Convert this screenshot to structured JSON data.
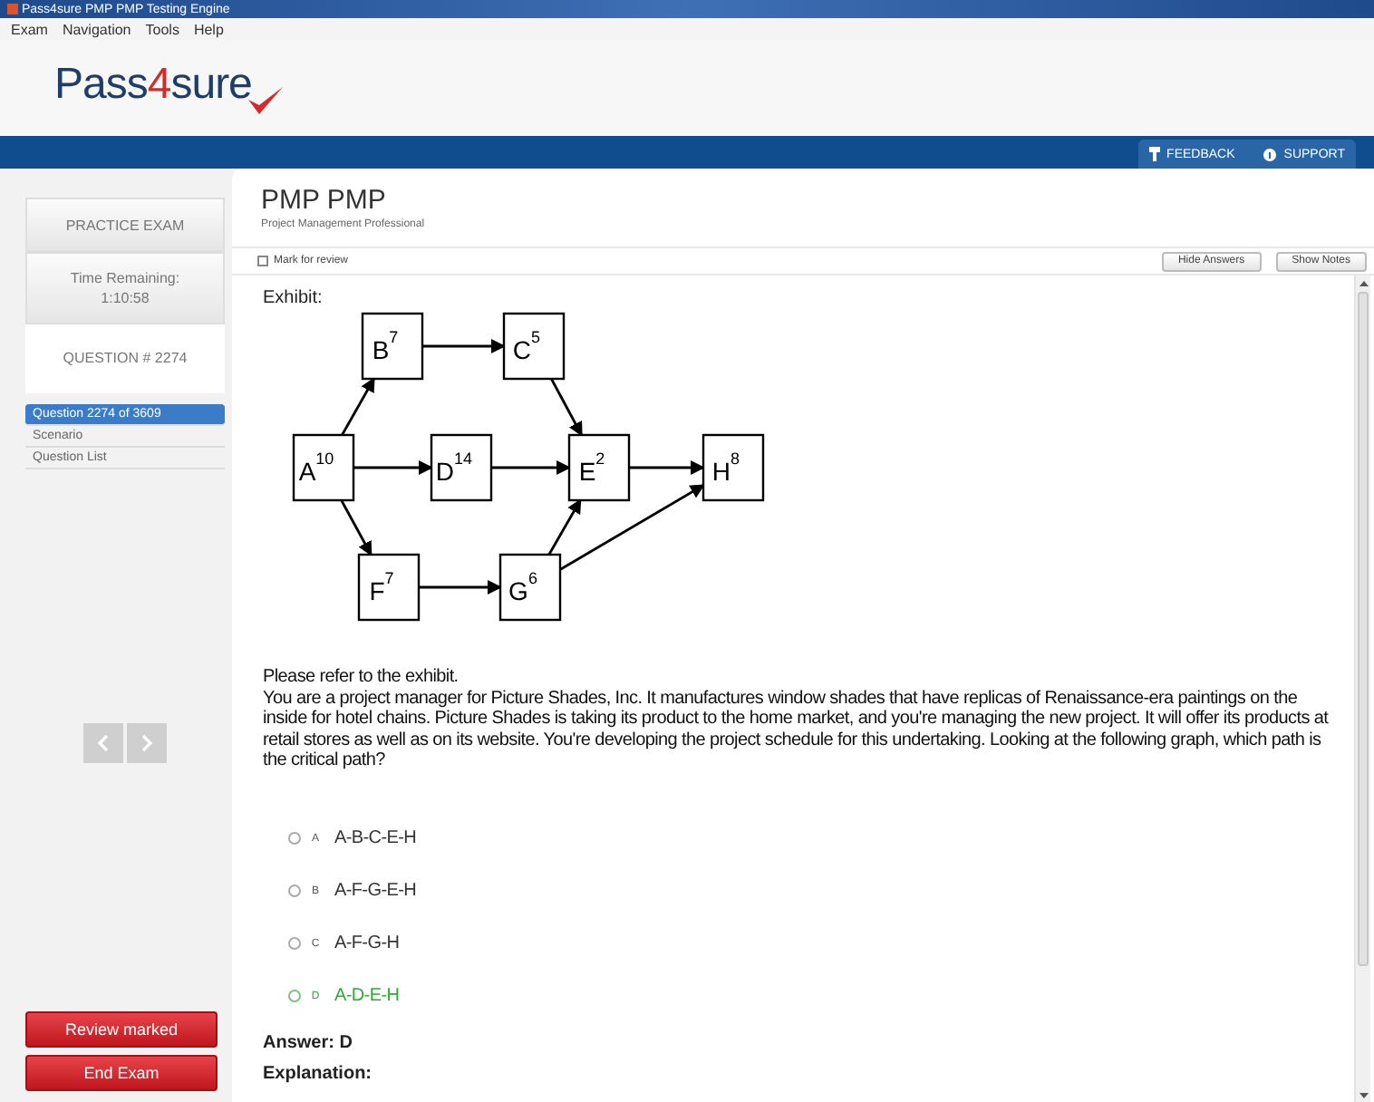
{
  "window": {
    "title": "Pass4sure PMP PMP Testing Engine"
  },
  "menu": [
    "Exam",
    "Navigation",
    "Tools",
    "Help"
  ],
  "logo": [
    {
      "text": "Pass",
      "color": "#1f3d6b"
    },
    {
      "text": "4",
      "color": "#d42a2a"
    },
    {
      "text": "sure",
      "color": "#1f3d6b"
    }
  ],
  "header_links": [
    "FEEDBACK",
    "SUPPORT"
  ],
  "sidebar": {
    "mode": "PRACTICE EXAM",
    "time_label": "Time Remaining:",
    "time": "1:10:58",
    "question_heading": "QUESTION # 2274",
    "items": [
      {
        "label": "Question 2274 of 3609",
        "selected": true
      },
      {
        "label": "Scenario",
        "selected": false
      },
      {
        "label": "Question List",
        "selected": false
      }
    ],
    "buttons": [
      "Review marked",
      "End Exam"
    ]
  },
  "exam": {
    "title": "PMP PMP",
    "subtitle": "Project Management Professional",
    "mark_for_review": {
      "label": "Mark for review",
      "checked": false
    },
    "buttons": [
      "Hide Answers",
      "Show Notes"
    ]
  },
  "exhibit": {
    "label": "Exhibit:",
    "nodes": [
      {
        "label": "B",
        "duration": "7"
      },
      {
        "label": "C",
        "duration": "5"
      },
      {
        "label": "A",
        "duration": "10"
      },
      {
        "label": "D",
        "duration": "14"
      },
      {
        "label": "E",
        "duration": "2"
      },
      {
        "label": "H",
        "duration": "8"
      },
      {
        "label": "F",
        "duration": "7"
      },
      {
        "label": "G",
        "duration": "6"
      }
    ]
  },
  "question": [
    "Please refer to the exhibit.",
    "You are a project manager for Picture Shades, Inc. It manufactures window shades that have replicas of Renaissance-era paintings on the inside for hotel chains. Picture Shades is taking its product to the home market, and you're managing the new project. It will offer its products at retail stores as well as on its website. You're developing the project schedule for this undertaking. Looking at the following graph, which path is the critical path?"
  ],
  "options": [
    {
      "letter": "A",
      "text": "A-B-C-E-H",
      "selected": false,
      "correct": false
    },
    {
      "letter": "B",
      "text": "A-F-G-E-H",
      "selected": false,
      "correct": false
    },
    {
      "letter": "C",
      "text": "A-F-G-H",
      "selected": false,
      "correct": false
    },
    {
      "letter": "D",
      "text": "A-D-E-H",
      "selected": false,
      "correct": true
    }
  ],
  "answer": "Answer: D",
  "explanation": "Explanation:"
}
